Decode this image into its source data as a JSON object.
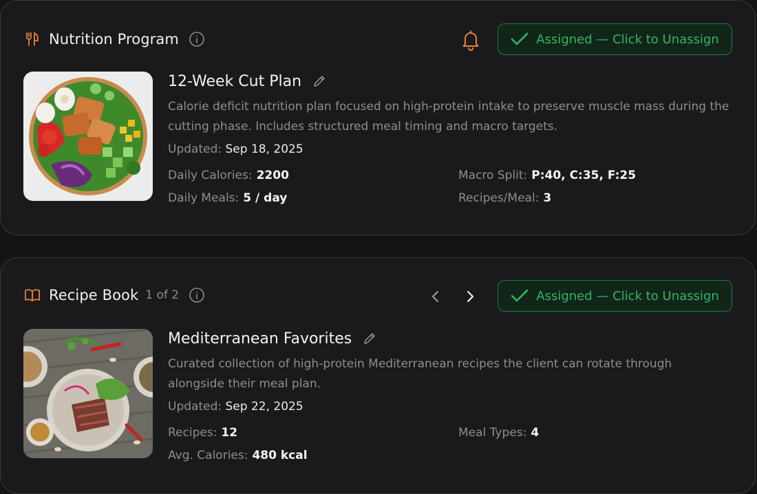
{
  "colors": {
    "accent_orange": "#e8823a",
    "success_green": "#30b765",
    "background": "#141416",
    "card": "#1a1a1c"
  },
  "nutrition_program": {
    "section_title": "Nutrition Program",
    "section_icon": "fork-knife-icon",
    "assign_button": "Assigned — Click to Unassign",
    "plan": {
      "title": "12-Week Cut Plan",
      "image": "salad-bowl-image",
      "description": "Calorie deficit nutrition plan focused on high-protein intake to preserve muscle mass during the cutting phase. Includes structured meal timing and macro targets.",
      "updated_label": "Updated:",
      "updated_value": "Sep 18, 2025",
      "stats": [
        {
          "label": "Daily Calories:",
          "value": "2200"
        },
        {
          "label": "Macro Split:",
          "value": "P:40, C:35, F:25"
        },
        {
          "label": "Daily Meals:",
          "value": "5 / day"
        },
        {
          "label": "Recipes/Meal:",
          "value": "3"
        }
      ]
    }
  },
  "recipe_book": {
    "section_title": "Recipe Book",
    "section_icon": "open-book-icon",
    "pager": "1 of 2",
    "assign_button": "Assigned — Click to Unassign",
    "book": {
      "title": "Mediterranean Favorites",
      "image": "mediterranean-dishes-image",
      "description": "Curated collection of high-protein Mediterranean recipes the client can rotate through alongside their meal plan.",
      "updated_label": "Updated:",
      "updated_value": "Sep 22, 2025",
      "stats": [
        {
          "label": "Recipes:",
          "value": "12"
        },
        {
          "label": "Meal Types:",
          "value": "4"
        },
        {
          "label": "Avg. Calories:",
          "value": "480 kcal"
        }
      ]
    }
  }
}
